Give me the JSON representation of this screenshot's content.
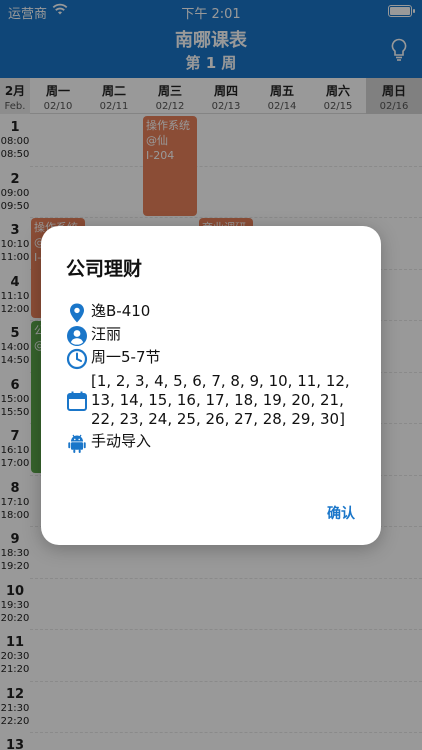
{
  "status_bar": {
    "carrier": "运营商",
    "time": "下午 2:01"
  },
  "nav": {
    "title": "南哪课表",
    "subtitle": "第 1 周"
  },
  "week": {
    "month": "2月",
    "month_en": "Feb.",
    "days": [
      {
        "name": "周一",
        "date": "02/10"
      },
      {
        "name": "周二",
        "date": "02/11"
      },
      {
        "name": "周三",
        "date": "02/12"
      },
      {
        "name": "周四",
        "date": "02/13"
      },
      {
        "name": "周五",
        "date": "02/14"
      },
      {
        "name": "周六",
        "date": "02/15"
      },
      {
        "name": "周日",
        "date": "02/16"
      }
    ]
  },
  "periods": [
    {
      "num": "1",
      "start": "08:00",
      "end": "08:50"
    },
    {
      "num": "2",
      "start": "09:00",
      "end": "09:50"
    },
    {
      "num": "3",
      "start": "10:10",
      "end": "11:00"
    },
    {
      "num": "4",
      "start": "11:10",
      "end": "12:00"
    },
    {
      "num": "5",
      "start": "14:00",
      "end": "14:50"
    },
    {
      "num": "6",
      "start": "15:00",
      "end": "15:50"
    },
    {
      "num": "7",
      "start": "16:10",
      "end": "17:00"
    },
    {
      "num": "8",
      "start": "17:10",
      "end": "18:00"
    },
    {
      "num": "9",
      "start": "18:30",
      "end": "19:20"
    },
    {
      "num": "10",
      "start": "19:30",
      "end": "20:20"
    },
    {
      "num": "11",
      "start": "20:30",
      "end": "21:20"
    },
    {
      "num": "12",
      "start": "21:30",
      "end": "22:20"
    },
    {
      "num": "13",
      "start": "",
      "end": ""
    }
  ],
  "courses": [
    {
      "name": "操作系统",
      "loc": "@仙",
      "room": "I-204"
    },
    {
      "name": "操作系统",
      "loc": "@",
      "room": "I-"
    },
    {
      "name": "商业调研",
      "loc": "",
      "room": ""
    },
    {
      "name": "公",
      "loc": "@",
      "room": ""
    }
  ],
  "colors": {
    "primary": "#1a76c9",
    "course_orange": "#e8805a",
    "course_green": "#5aa54a"
  },
  "dialog": {
    "title": "公司理财",
    "location": "逸B-410",
    "teacher": "汪丽",
    "time": "周一5-7节",
    "weeks": "[1, 2, 3, 4, 5, 6, 7, 8, 9, 10, 11, 12, 13, 14, 15, 16, 17, 18, 19, 20, 21, 22, 23, 24, 25, 26, 27, 28, 29, 30]",
    "source": "手动导入",
    "confirm_label": "确认",
    "icons": [
      "location-pin-icon",
      "person-icon",
      "clock-icon",
      "calendar-icon",
      "android-icon"
    ]
  }
}
